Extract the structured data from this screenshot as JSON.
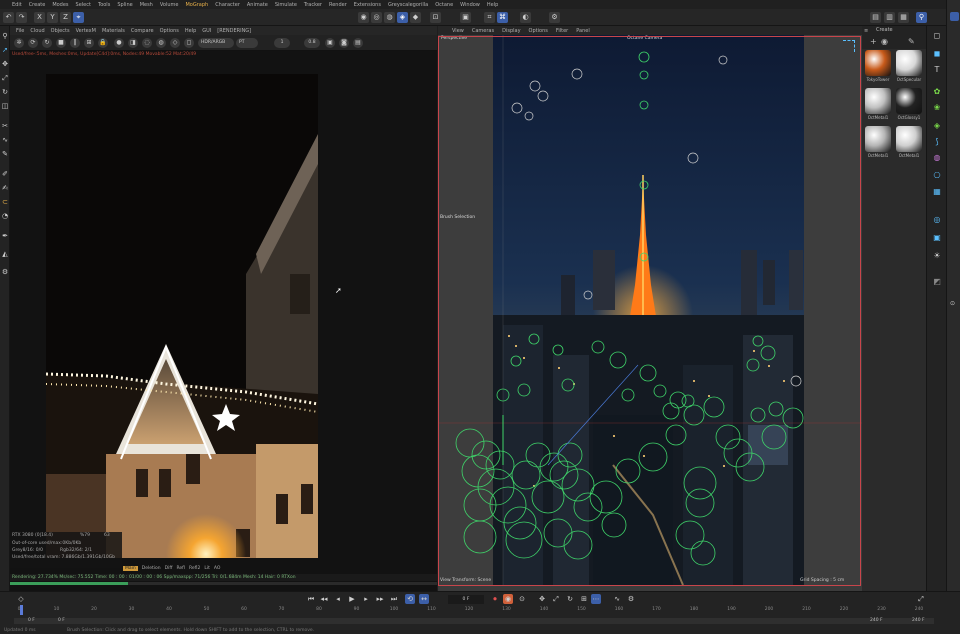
{
  "menubar": {
    "items": [
      "Edit",
      "Create",
      "Modes",
      "Select",
      "Tools",
      "Spline",
      "Mesh",
      "Volume",
      "MoGraph",
      "Character",
      "Animate",
      "Simulate",
      "Tracker",
      "Render",
      "Extensions",
      "Greyscalegorilla",
      "Octane",
      "Window",
      "Help"
    ],
    "highlight": "MoGraph"
  },
  "left_panel": {
    "menu": [
      "File",
      "Cloud",
      "Objects",
      "VertexM",
      "Materials",
      "Compare",
      "Options",
      "Help",
      "GUI",
      "[RENDERING]"
    ],
    "toolbar": {
      "mode": "HDR/ARGB",
      "camera": "PT",
      "value1": "1",
      "value2": "0.8"
    },
    "status_line": "Used/free-:5ms, Meshes:0ms, Update[C4d]:0ms, Nodes:49 Movable:52 Mat:20/49",
    "status_line_right": "",
    "render_info": {
      "gpu": "RTX 3080 (0|18.4)",
      "gpu_pct": "%79",
      "gpu_temp": "63",
      "out_of_core": "Out-of-core used/max:0Kb/0Kb",
      "grey": "Grey8/16: 0/0",
      "rgb": "Rgb32/64: 2/1",
      "vram": "Used/free/total vram: 7.886Gb/1.391Gb/10Gb"
    },
    "chips": [
      "Main",
      "Deletion",
      "Diff",
      "Refl",
      "Refl2",
      "Lit",
      "AO"
    ],
    "chips_active": "Main",
    "progress_text": "Rendering: 27.734%  Ms/sec: 75.552  Time: 00 : 00 : 01/00 : 00 : 06  Spp/maxspp: 71/256  Tri: 0/1.684m  Mesh: 14  Hair: 0  RTXon",
    "progress_pct": 27.734
  },
  "right_panel": {
    "menu": [
      "View",
      "Cameras",
      "Display",
      "Options",
      "Filter",
      "Panel"
    ],
    "viewport_label": "Perspective",
    "camera_label": "Octane Camera",
    "brush_label": "Brush Selection",
    "view_transform": "View Transform: Scene",
    "grid_spacing": "Grid Spacing : 5 cm"
  },
  "materials": {
    "header": "Create",
    "items": [
      {
        "name": "TokyoTower",
        "color": "#c85a1a"
      },
      {
        "name": "OctSpecular",
        "color": "#d8d8d8"
      },
      {
        "name": "OctMetal1",
        "color": "#c0c0c0"
      },
      {
        "name": "OctGlossy1",
        "color": "#222"
      },
      {
        "name": "OctMetal1",
        "color": "#b5b5b5"
      },
      {
        "name": "OctMetal1",
        "color": "#cfcfcf"
      }
    ]
  },
  "timeline": {
    "current_frame": "0 F",
    "start": "0 F",
    "range_start": "0 F",
    "range_end": "240 F",
    "end": "240 F",
    "ticks": [
      "0",
      "10",
      "20",
      "30",
      "40",
      "50",
      "60",
      "70",
      "80",
      "90",
      "100",
      "110",
      "120",
      "130",
      "140",
      "150",
      "160",
      "170",
      "180",
      "190",
      "200",
      "210",
      "220",
      "230",
      "240"
    ]
  },
  "statusbar": {
    "left": "Updated 0 ms",
    "hint": "Brush Selection: Click and drag to select elements. Hold down SHIFT to add to the selection, CTRL to remove."
  },
  "colors": {
    "accent": "#3c5fa8",
    "render_border": "#c8454b",
    "selection_green": "#3fd46a",
    "progress": "#3b9e5a"
  }
}
